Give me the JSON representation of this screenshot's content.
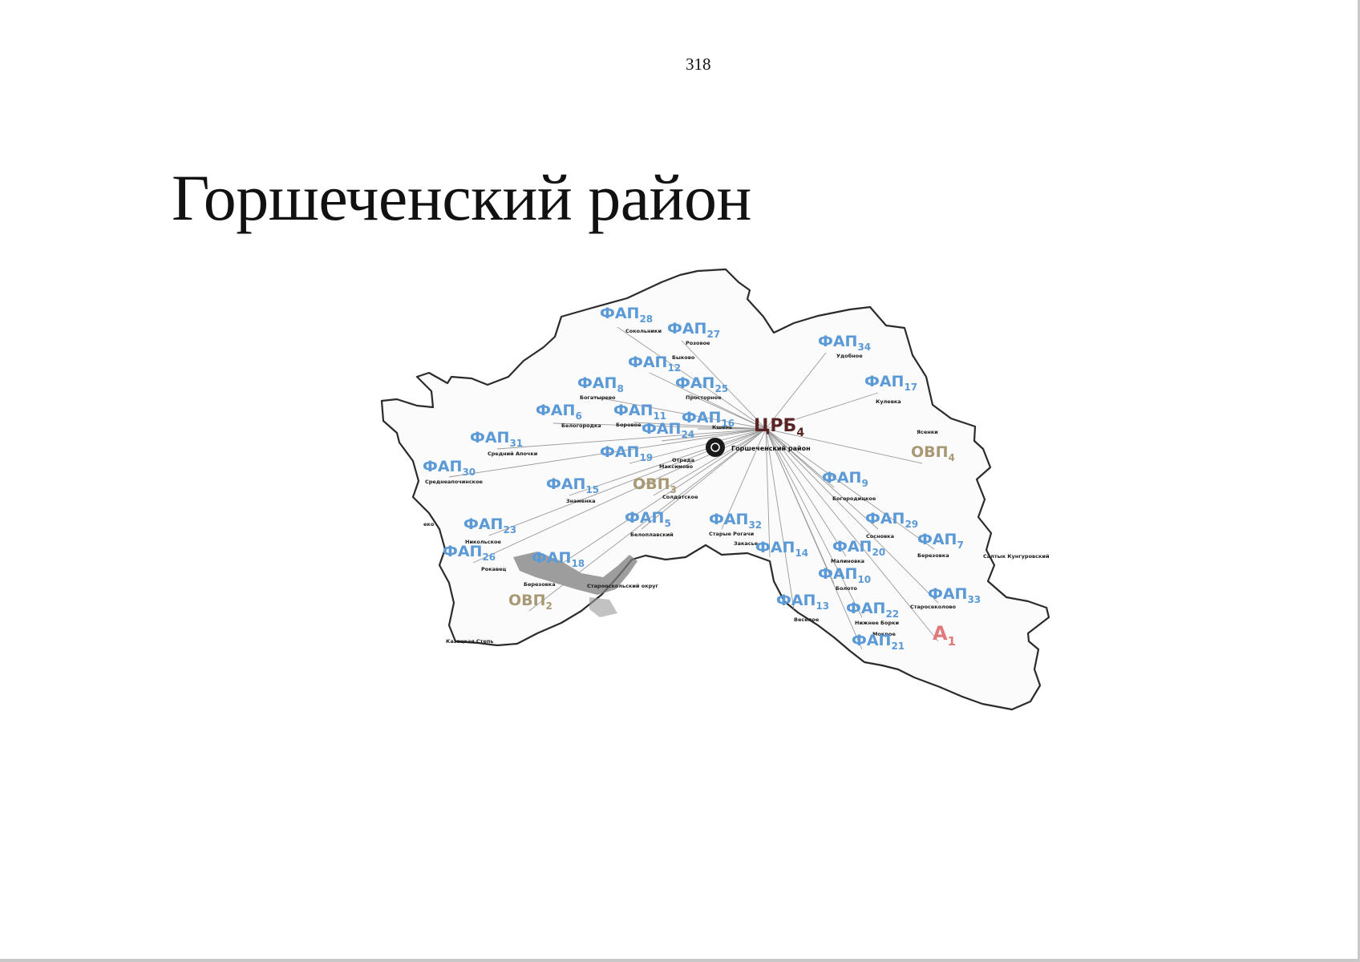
{
  "page_number": "318",
  "title": "Горшеченский район",
  "colors": {
    "fap": "#5b9ad6",
    "ovp": "#a89873",
    "crb": "#5a2424",
    "a": "#e07a7a",
    "border": "#2b2b2b",
    "spoke": "#9a9a9a"
  },
  "center": {
    "name": "Горшеченский район",
    "icon": "location-pin-icon"
  },
  "labels": [
    {
      "id": "crb4",
      "main": "ЦРБ",
      "sub": "4",
      "type": "crb"
    },
    {
      "id": "fap28",
      "main": "ФАП",
      "sub": "28",
      "type": "fap"
    },
    {
      "id": "fap27",
      "main": "ФАП",
      "sub": "27",
      "type": "fap"
    },
    {
      "id": "fap12",
      "main": "ФАП",
      "sub": "12",
      "type": "fap"
    },
    {
      "id": "fap8",
      "main": "ФАП",
      "sub": "8",
      "type": "fap"
    },
    {
      "id": "fap25",
      "main": "ФАП",
      "sub": "25",
      "type": "fap"
    },
    {
      "id": "fap6",
      "main": "ФАП",
      "sub": "6",
      "type": "fap"
    },
    {
      "id": "fap11",
      "main": "ФАП",
      "sub": "11",
      "type": "fap"
    },
    {
      "id": "fap16",
      "main": "ФАП",
      "sub": "16",
      "type": "fap"
    },
    {
      "id": "fap24",
      "main": "ФАП",
      "sub": "24",
      "type": "fap"
    },
    {
      "id": "fap31",
      "main": "ФАП",
      "sub": "31",
      "type": "fap"
    },
    {
      "id": "fap19",
      "main": "ФАП",
      "sub": "19",
      "type": "fap"
    },
    {
      "id": "fap30",
      "main": "ФАП",
      "sub": "30",
      "type": "fap"
    },
    {
      "id": "fap15",
      "main": "ФАП",
      "sub": "15",
      "type": "fap"
    },
    {
      "id": "ovp3",
      "main": "ОВП",
      "sub": "3",
      "type": "ovp"
    },
    {
      "id": "fap5",
      "main": "ФАП",
      "sub": "5",
      "type": "fap"
    },
    {
      "id": "fap32",
      "main": "ФАП",
      "sub": "32",
      "type": "fap"
    },
    {
      "id": "fap23",
      "main": "ФАП",
      "sub": "23",
      "type": "fap"
    },
    {
      "id": "fap26",
      "main": "ФАП",
      "sub": "26",
      "type": "fap"
    },
    {
      "id": "fap18",
      "main": "ФАП",
      "sub": "18",
      "type": "fap"
    },
    {
      "id": "ovp2",
      "main": "ОВП",
      "sub": "2",
      "type": "ovp"
    },
    {
      "id": "fap34",
      "main": "ФАП",
      "sub": "34",
      "type": "fap"
    },
    {
      "id": "fap17",
      "main": "ФАП",
      "sub": "17",
      "type": "fap"
    },
    {
      "id": "ovp4",
      "main": "ОВП",
      "sub": "4",
      "type": "ovp"
    },
    {
      "id": "fap9",
      "main": "ФАП",
      "sub": "9",
      "type": "fap"
    },
    {
      "id": "fap29",
      "main": "ФАП",
      "sub": "29",
      "type": "fap"
    },
    {
      "id": "fap7",
      "main": "ФАП",
      "sub": "7",
      "type": "fap"
    },
    {
      "id": "fap14",
      "main": "ФАП",
      "sub": "14",
      "type": "fap"
    },
    {
      "id": "fap20",
      "main": "ФАП",
      "sub": "20",
      "type": "fap"
    },
    {
      "id": "fap10",
      "main": "ФАП",
      "sub": "10",
      "type": "fap"
    },
    {
      "id": "fap33",
      "main": "ФАП",
      "sub": "33",
      "type": "fap"
    },
    {
      "id": "fap13",
      "main": "ФАП",
      "sub": "13",
      "type": "fap"
    },
    {
      "id": "fap22",
      "main": "ФАП",
      "sub": "22",
      "type": "fap"
    },
    {
      "id": "fap21",
      "main": "ФАП",
      "sub": "21",
      "type": "fap"
    },
    {
      "id": "a1",
      "main": "А",
      "sub": "1",
      "type": "a"
    }
  ],
  "villages": [
    "Сокольники",
    "Розовое",
    "Быково",
    "Просторное",
    "Богатырево",
    "Белогородка",
    "Боровое",
    "Кшень",
    "Средний Апочки",
    "Отрада",
    "Максимово",
    "Среднеапочинское",
    "Знаменка",
    "Солдатское",
    "Никольское",
    "Белоплавский",
    "Старые Рогачи",
    "Закасье",
    "Удобное",
    "Кулевка",
    "Ясенки",
    "Богородицкое",
    "Сосновка",
    "Березовка",
    "Малиновка",
    "Болото",
    "Старосеколово",
    "Веселое",
    "Нижнее Борки",
    "Мокрое",
    "Рокавец",
    "Березовка",
    "Старооскольский округ",
    "Казацкая Степь",
    "Салтык Кунгуровский",
    "еко"
  ]
}
